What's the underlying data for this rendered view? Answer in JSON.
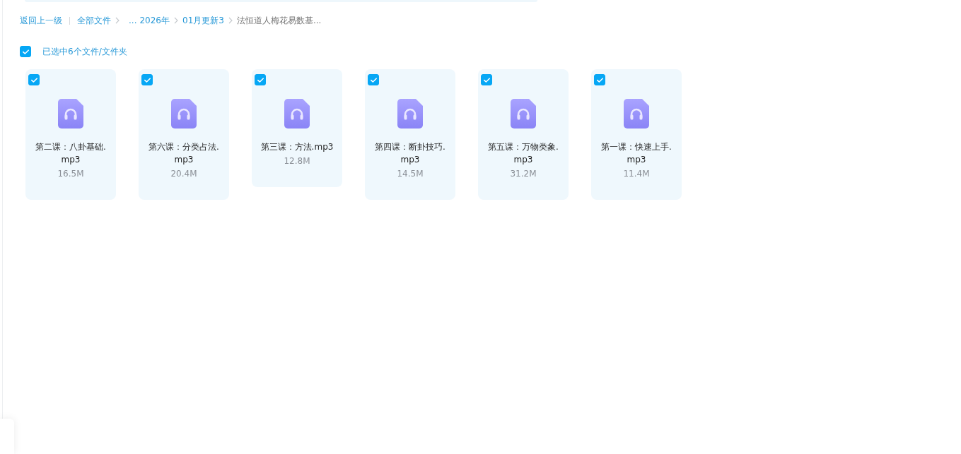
{
  "breadcrumb": {
    "back": "返回上一级",
    "items": [
      {
        "label": "全部文件",
        "kind": "link",
        "current": false
      },
      {
        "label": "...",
        "kind": "ellipsis",
        "current": false
      },
      {
        "label": "2026年",
        "kind": "link",
        "current": false
      },
      {
        "label": "01月更新3",
        "kind": "link",
        "current": false
      },
      {
        "label": "法恒道人梅花易数基...",
        "kind": "link",
        "current": true
      }
    ]
  },
  "selection": {
    "checked": true,
    "label": "已选中6个文件/文件夹"
  },
  "files": [
    {
      "name": "第二课：八卦基础.mp3",
      "size": "16.5M",
      "checked": true
    },
    {
      "name": "第六课：分类占法.mp3",
      "size": "20.4M",
      "checked": true
    },
    {
      "name": "第三课：方法.mp3",
      "size": "12.8M",
      "checked": true
    },
    {
      "name": "第四课：断卦技巧.mp3",
      "size": "14.5M",
      "checked": true
    },
    {
      "name": "第五课：万物类象.mp3",
      "size": "31.2M",
      "checked": true
    },
    {
      "name": "第一课：快速上手.mp3",
      "size": "11.4M",
      "checked": true
    }
  ]
}
